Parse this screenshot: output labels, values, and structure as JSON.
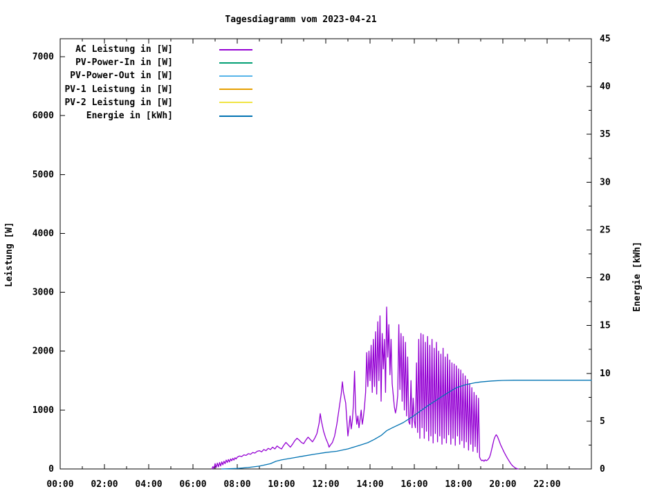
{
  "chart_data": {
    "type": "line",
    "title": "Tagesdiagramm vom 2023-04-21",
    "x_axis": {
      "label": "",
      "range_hours": [
        0,
        24
      ],
      "major_tick_hours": [
        0,
        2,
        4,
        6,
        8,
        10,
        12,
        14,
        16,
        18,
        20,
        22
      ],
      "major_tick_labels": [
        "00:00",
        "02:00",
        "04:00",
        "06:00",
        "08:00",
        "10:00",
        "12:00",
        "14:00",
        "16:00",
        "18:00",
        "20:00",
        "22:00"
      ],
      "minor_tick_hours": [
        1,
        3,
        5,
        7,
        9,
        11,
        13,
        15,
        17,
        19,
        21,
        23
      ]
    },
    "y_left": {
      "label": "Leistung [W]",
      "range": [
        0,
        7300
      ],
      "tick_values": [
        0,
        1000,
        2000,
        3000,
        4000,
        5000,
        6000,
        7000
      ],
      "tick_labels": [
        "0",
        "1000",
        "2000",
        "3000",
        "4000",
        "5000",
        "6000",
        "7000"
      ]
    },
    "y_right": {
      "label": "Energie [kWh]",
      "range": [
        0,
        45
      ],
      "tick_values": [
        0,
        5,
        10,
        15,
        20,
        25,
        30,
        35,
        40,
        45
      ],
      "tick_labels": [
        "0",
        "5",
        "10",
        "15",
        "20",
        "25",
        "30",
        "35",
        "40",
        "45"
      ],
      "minor_tick_values": [
        2.5,
        7.5,
        12.5,
        17.5,
        22.5,
        27.5,
        32.5,
        37.5,
        42.5
      ]
    },
    "grid": false,
    "legend_position": "top-left-inside",
    "series": [
      {
        "name": "AC Leistung in [W]",
        "color": "#9400D3",
        "axis": "left",
        "points": [
          [
            6.85,
            0
          ],
          [
            6.9,
            40
          ],
          [
            6.95,
            10
          ],
          [
            7.0,
            90
          ],
          [
            7.05,
            25
          ],
          [
            7.1,
            100
          ],
          [
            7.15,
            35
          ],
          [
            7.2,
            110
          ],
          [
            7.25,
            50
          ],
          [
            7.3,
            120
          ],
          [
            7.35,
            70
          ],
          [
            7.4,
            130
          ],
          [
            7.45,
            90
          ],
          [
            7.5,
            150
          ],
          [
            7.55,
            110
          ],
          [
            7.6,
            160
          ],
          [
            7.65,
            120
          ],
          [
            7.7,
            170
          ],
          [
            7.75,
            140
          ],
          [
            7.8,
            180
          ],
          [
            7.85,
            150
          ],
          [
            7.9,
            190
          ],
          [
            7.95,
            170
          ],
          [
            8.0,
            200
          ],
          [
            8.1,
            220
          ],
          [
            8.2,
            210
          ],
          [
            8.3,
            240
          ],
          [
            8.4,
            230
          ],
          [
            8.5,
            260
          ],
          [
            8.6,
            250
          ],
          [
            8.7,
            280
          ],
          [
            8.8,
            270
          ],
          [
            8.9,
            300
          ],
          [
            9.0,
            310
          ],
          [
            9.1,
            290
          ],
          [
            9.2,
            330
          ],
          [
            9.3,
            310
          ],
          [
            9.4,
            350
          ],
          [
            9.5,
            330
          ],
          [
            9.6,
            370
          ],
          [
            9.7,
            340
          ],
          [
            9.8,
            390
          ],
          [
            9.9,
            360
          ],
          [
            10.0,
            340
          ],
          [
            10.1,
            400
          ],
          [
            10.2,
            450
          ],
          [
            10.3,
            410
          ],
          [
            10.4,
            370
          ],
          [
            10.5,
            420
          ],
          [
            10.6,
            480
          ],
          [
            10.7,
            520
          ],
          [
            10.8,
            490
          ],
          [
            10.9,
            450
          ],
          [
            11.0,
            430
          ],
          [
            11.1,
            490
          ],
          [
            11.2,
            540
          ],
          [
            11.3,
            500
          ],
          [
            11.4,
            460
          ],
          [
            11.5,
            520
          ],
          [
            11.6,
            600
          ],
          [
            11.7,
            780
          ],
          [
            11.75,
            940
          ],
          [
            11.8,
            820
          ],
          [
            11.9,
            640
          ],
          [
            12.0,
            520
          ],
          [
            12.1,
            430
          ],
          [
            12.15,
            370
          ],
          [
            12.2,
            400
          ],
          [
            12.3,
            450
          ],
          [
            12.4,
            560
          ],
          [
            12.5,
            760
          ],
          [
            12.6,
            1020
          ],
          [
            12.7,
            1280
          ],
          [
            12.75,
            1480
          ],
          [
            12.8,
            1300
          ],
          [
            12.9,
            1120
          ],
          [
            13.0,
            560
          ],
          [
            13.05,
            720
          ],
          [
            13.1,
            900
          ],
          [
            13.15,
            680
          ],
          [
            13.2,
            820
          ],
          [
            13.25,
            1100
          ],
          [
            13.3,
            1660
          ],
          [
            13.35,
            980
          ],
          [
            13.4,
            760
          ],
          [
            13.45,
            900
          ],
          [
            13.5,
            700
          ],
          [
            13.55,
            840
          ],
          [
            13.6,
            1000
          ],
          [
            13.65,
            760
          ],
          [
            13.7,
            880
          ],
          [
            13.75,
            1060
          ],
          [
            13.8,
            1300
          ],
          [
            13.85,
            1975
          ],
          [
            13.9,
            1400
          ],
          [
            13.95,
            2000
          ],
          [
            14.0,
            1500
          ],
          [
            14.05,
            2100
          ],
          [
            14.1,
            1300
          ],
          [
            14.15,
            2200
          ],
          [
            14.2,
            1400
          ],
          [
            14.25,
            2330
          ],
          [
            14.3,
            1270
          ],
          [
            14.35,
            2500
          ],
          [
            14.4,
            1500
          ],
          [
            14.45,
            2600
          ],
          [
            14.5,
            1150
          ],
          [
            14.55,
            2300
          ],
          [
            14.6,
            1700
          ],
          [
            14.65,
            2200
          ],
          [
            14.7,
            1300
          ],
          [
            14.75,
            2750
          ],
          [
            14.8,
            1900
          ],
          [
            14.85,
            2450
          ],
          [
            14.9,
            1600
          ],
          [
            14.95,
            2200
          ],
          [
            15.0,
            1450
          ],
          [
            15.05,
            1250
          ],
          [
            15.1,
            1050
          ],
          [
            15.15,
            950
          ],
          [
            15.2,
            1050
          ],
          [
            15.25,
            1250
          ],
          [
            15.3,
            2450
          ],
          [
            15.35,
            1350
          ],
          [
            15.4,
            2300
          ],
          [
            15.45,
            1150
          ],
          [
            15.5,
            2250
          ],
          [
            15.55,
            1000
          ],
          [
            15.6,
            2150
          ],
          [
            15.65,
            900
          ],
          [
            15.7,
            1900
          ],
          [
            15.75,
            800
          ],
          [
            15.8,
            760
          ],
          [
            15.85,
            1500
          ],
          [
            15.9,
            700
          ],
          [
            15.95,
            1200
          ],
          [
            16.0,
            820
          ],
          [
            16.05,
            700
          ],
          [
            16.1,
            1800
          ],
          [
            16.15,
            620
          ],
          [
            16.2,
            2200
          ],
          [
            16.25,
            520
          ],
          [
            16.3,
            2300
          ],
          [
            16.35,
            700
          ],
          [
            16.4,
            2280
          ],
          [
            16.45,
            520
          ],
          [
            16.5,
            2150
          ],
          [
            16.55,
            640
          ],
          [
            16.6,
            2250
          ],
          [
            16.65,
            480
          ],
          [
            16.7,
            2100
          ],
          [
            16.75,
            560
          ],
          [
            16.8,
            2200
          ],
          [
            16.85,
            440
          ],
          [
            16.9,
            2050
          ],
          [
            16.95,
            600
          ],
          [
            17.0,
            2150
          ],
          [
            17.05,
            460
          ],
          [
            17.1,
            2000
          ],
          [
            17.15,
            560
          ],
          [
            17.2,
            1950
          ],
          [
            17.25,
            420
          ],
          [
            17.3,
            2050
          ],
          [
            17.35,
            520
          ],
          [
            17.4,
            1900
          ],
          [
            17.45,
            440
          ],
          [
            17.5,
            1950
          ],
          [
            17.55,
            580
          ],
          [
            17.6,
            1850
          ],
          [
            17.65,
            420
          ],
          [
            17.7,
            1800
          ],
          [
            17.75,
            520
          ],
          [
            17.8,
            1780
          ],
          [
            17.85,
            400
          ],
          [
            17.9,
            1750
          ],
          [
            17.95,
            560
          ],
          [
            18.0,
            1700
          ],
          [
            18.05,
            420
          ],
          [
            18.1,
            1680
          ],
          [
            18.15,
            480
          ],
          [
            18.2,
            1620
          ],
          [
            18.25,
            360
          ],
          [
            18.3,
            1580
          ],
          [
            18.35,
            460
          ],
          [
            18.4,
            1520
          ],
          [
            18.45,
            320
          ],
          [
            18.5,
            1450
          ],
          [
            18.55,
            420
          ],
          [
            18.6,
            1380
          ],
          [
            18.65,
            300
          ],
          [
            18.7,
            1300
          ],
          [
            18.75,
            380
          ],
          [
            18.8,
            1250
          ],
          [
            18.85,
            280
          ],
          [
            18.9,
            1200
          ],
          [
            18.95,
            200
          ],
          [
            19.0,
            160
          ],
          [
            19.05,
            140
          ],
          [
            19.1,
            150
          ],
          [
            19.15,
            130
          ],
          [
            19.2,
            155
          ],
          [
            19.25,
            140
          ],
          [
            19.3,
            150
          ],
          [
            19.35,
            170
          ],
          [
            19.4,
            200
          ],
          [
            19.45,
            260
          ],
          [
            19.5,
            340
          ],
          [
            19.55,
            420
          ],
          [
            19.6,
            500
          ],
          [
            19.65,
            550
          ],
          [
            19.7,
            580
          ],
          [
            19.75,
            555
          ],
          [
            19.8,
            510
          ],
          [
            19.85,
            460
          ],
          [
            19.9,
            410
          ],
          [
            19.95,
            370
          ],
          [
            20.0,
            330
          ],
          [
            20.05,
            290
          ],
          [
            20.1,
            255
          ],
          [
            20.15,
            220
          ],
          [
            20.2,
            185
          ],
          [
            20.25,
            155
          ],
          [
            20.3,
            125
          ],
          [
            20.35,
            95
          ],
          [
            20.4,
            70
          ],
          [
            20.45,
            50
          ],
          [
            20.5,
            35
          ],
          [
            20.55,
            20
          ],
          [
            20.6,
            10
          ],
          [
            20.65,
            5
          ],
          [
            20.7,
            0
          ]
        ]
      },
      {
        "name": "PV-Power-In in [W]",
        "color": "#009E73",
        "axis": "left",
        "points": []
      },
      {
        "name": "PV-Power-Out in [W]",
        "color": "#56B4E9",
        "axis": "left",
        "points": []
      },
      {
        "name": "PV-1 Leistung in [W]",
        "color": "#E69F00",
        "axis": "left",
        "points": []
      },
      {
        "name": "PV-2 Leistung in [W]",
        "color": "#F0E442",
        "axis": "left",
        "points": []
      },
      {
        "name": "Energie in [kWh]",
        "color": "#0072B2",
        "axis": "right",
        "points": [
          [
            7.3,
            0
          ],
          [
            8.0,
            0.05
          ],
          [
            8.5,
            0.15
          ],
          [
            9.0,
            0.3
          ],
          [
            9.5,
            0.55
          ],
          [
            9.75,
            0.8
          ],
          [
            10.0,
            0.95
          ],
          [
            10.5,
            1.15
          ],
          [
            11.0,
            1.35
          ],
          [
            11.5,
            1.55
          ],
          [
            12.0,
            1.72
          ],
          [
            12.5,
            1.85
          ],
          [
            13.0,
            2.1
          ],
          [
            13.5,
            2.45
          ],
          [
            13.9,
            2.75
          ],
          [
            14.2,
            3.1
          ],
          [
            14.5,
            3.5
          ],
          [
            14.75,
            4.0
          ],
          [
            15.0,
            4.3
          ],
          [
            15.5,
            4.85
          ],
          [
            16.0,
            5.6
          ],
          [
            16.3,
            6.1
          ],
          [
            16.6,
            6.6
          ],
          [
            17.0,
            7.2
          ],
          [
            17.4,
            7.8
          ],
          [
            17.9,
            8.5
          ],
          [
            18.3,
            8.8
          ],
          [
            18.7,
            9.0
          ],
          [
            19.0,
            9.1
          ],
          [
            19.5,
            9.2
          ],
          [
            20.0,
            9.26
          ],
          [
            20.5,
            9.28
          ],
          [
            24.0,
            9.28
          ]
        ]
      }
    ]
  },
  "colors": {
    "frame": "#000000",
    "text": "#000000",
    "background": "#ffffff"
  }
}
